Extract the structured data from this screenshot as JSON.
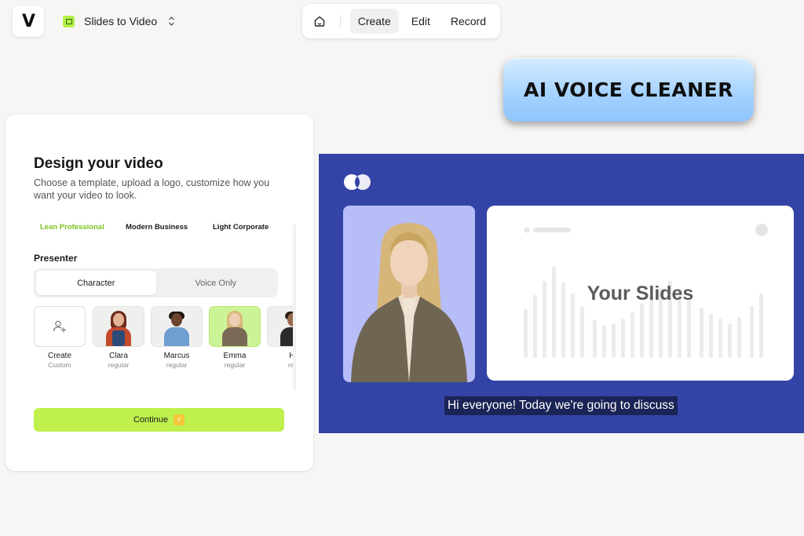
{
  "header": {
    "logo_letter": "V",
    "project_name": "Slides to Video",
    "nav": {
      "tabs": [
        "Create",
        "Edit",
        "Record"
      ],
      "active_tab": "Create"
    }
  },
  "promo": {
    "label": "AI VOICE CLEANER"
  },
  "design_panel": {
    "title": "Design your video",
    "description": "Choose a template, upload a logo, customize how you want your video to look.",
    "templates": [
      "Lean Professional",
      "Modern Business",
      "Light Corporate"
    ],
    "active_template": "Lean Professional",
    "presenter_label": "Presenter",
    "presenter_modes": [
      "Character",
      "Voice Only"
    ],
    "active_mode": "Character",
    "presenters": [
      {
        "name": "Create",
        "subtitle": "Custom"
      },
      {
        "name": "Clara",
        "subtitle": "regular"
      },
      {
        "name": "Marcus",
        "subtitle": "regular"
      },
      {
        "name": "Emma",
        "subtitle": "regular"
      },
      {
        "name": "Hi",
        "subtitle": "reg"
      }
    ],
    "selected_presenter": "Emma",
    "continue_label": "Continue",
    "accent_color": "#bff04d"
  },
  "preview": {
    "background_color": "#3344a6",
    "slide_title": "Your Slides",
    "caption": "Hi everyone! Today we're going to discuss"
  }
}
